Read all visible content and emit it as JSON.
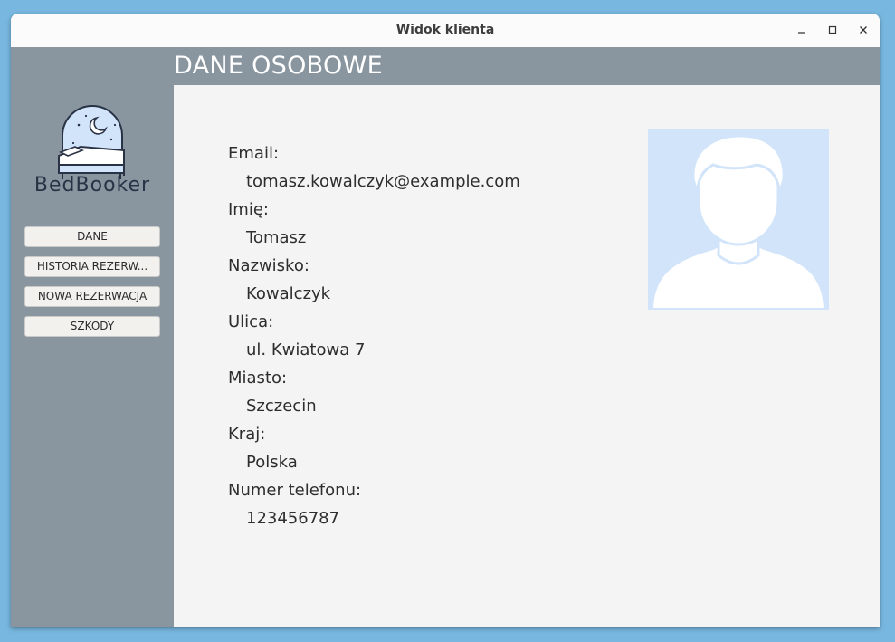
{
  "window": {
    "title": "Widok klienta",
    "minimize_icon": "minimize-icon",
    "maximize_icon": "maximize-icon",
    "close_icon": "close-icon"
  },
  "header": {
    "title": "DANE OSOBOWE"
  },
  "sidebar": {
    "logo_text": "BedBooker",
    "logo_icon": "bed-moon-logo-icon",
    "items": [
      {
        "label": "DANE"
      },
      {
        "label": "HISTORIA REZERW..."
      },
      {
        "label": "NOWA REZERWACJA"
      },
      {
        "label": "SZKODY"
      }
    ]
  },
  "profile": {
    "fields": [
      {
        "label": "Email:",
        "value": "tomasz.kowalczyk@example.com"
      },
      {
        "label": "Imię:",
        "value": "Tomasz"
      },
      {
        "label": "Nazwisko:",
        "value": "Kowalczyk"
      },
      {
        "label": "Ulica:",
        "value": "ul. Kwiatowa 7"
      },
      {
        "label": "Miasto:",
        "value": "Szczecin"
      },
      {
        "label": "Kraj:",
        "value": "Polska"
      },
      {
        "label": "Numer telefonu:",
        "value": "123456787"
      }
    ],
    "avatar_icon": "user-avatar-placeholder-icon"
  },
  "colors": {
    "sidebar": "#8996a0",
    "content": "#f4f4f4",
    "avatar_bg": "#d2e4f9",
    "desktop": "#78b8e0"
  }
}
